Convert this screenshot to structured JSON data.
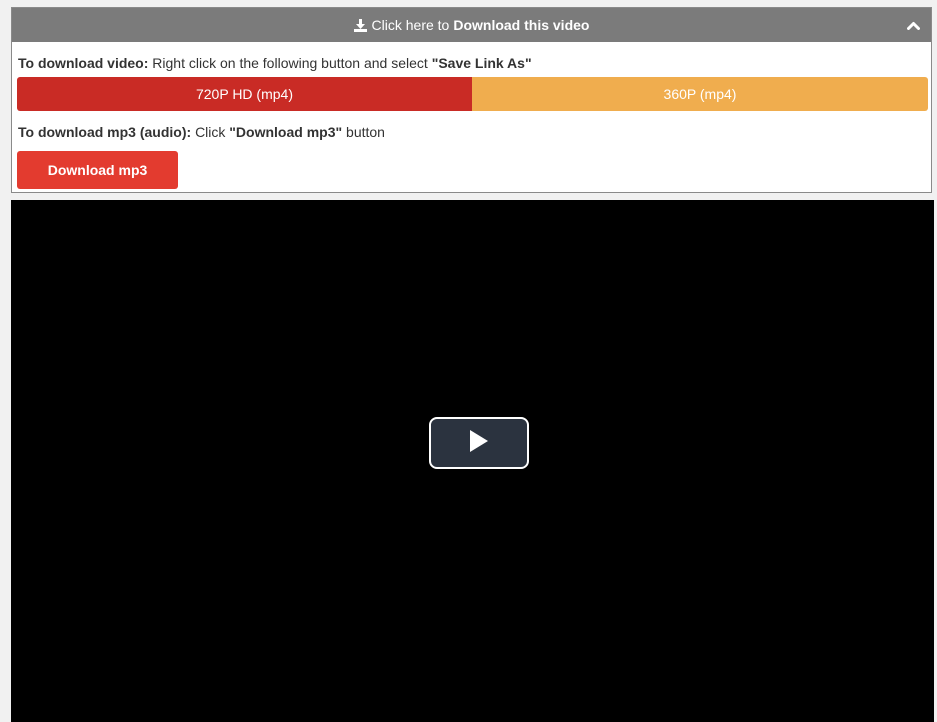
{
  "panel": {
    "header_prefix": "Click here to",
    "header_bold": "Download this video",
    "download_icon": "download-icon",
    "collapse_icon": "chevron-up-icon"
  },
  "video_instruction": {
    "label": "To download video:",
    "text_before": "Right click on the following button and select",
    "emphasis": "\"Save Link As\""
  },
  "quality_options": [
    {
      "label": "720P HD (mp4)",
      "color": "#c92b25"
    },
    {
      "label": "360P (mp4)",
      "color": "#f0ad4e"
    }
  ],
  "mp3_instruction": {
    "label": "To download mp3 (audio):",
    "text_before": "Click",
    "emphasis": "\"Download mp3\"",
    "text_after": "button"
  },
  "mp3_button_label": "Download mp3",
  "video": {
    "play_icon": "play-icon"
  },
  "colors": {
    "header_bg": "#7b7b7b",
    "mp3_button": "#e33b2f",
    "player_bg": "#000000",
    "play_button_bg": "#2b333f"
  }
}
